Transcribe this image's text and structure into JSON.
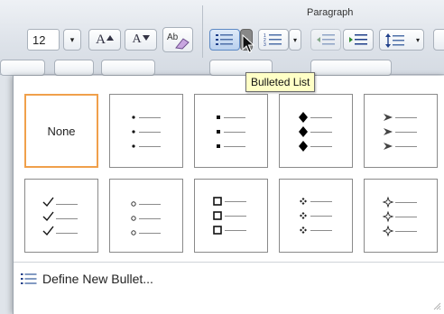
{
  "ribbon": {
    "group_title": "Paragraph",
    "font_size_value": "12",
    "font_size_arrow": "▾",
    "grow_font_label": "A",
    "shrink_font_label": "A",
    "clear_formatting_label": "Ab",
    "split_arrow": "▾",
    "bullets_icon": "bulleted-list-icon",
    "numbering_icon": "numbered-list-icon",
    "accent_color": "#5d89c4"
  },
  "tooltip": {
    "text": "Bulleted List"
  },
  "bullet_library": {
    "none_label": "None",
    "selected_border_color": "#f0a04b",
    "items": [
      {
        "name": "none"
      },
      {
        "name": "small-dot"
      },
      {
        "name": "square-dot"
      },
      {
        "name": "black-diamond"
      },
      {
        "name": "arrowhead"
      },
      {
        "name": "checkmark"
      },
      {
        "name": "hollow-circle"
      },
      {
        "name": "hollow-square"
      },
      {
        "name": "four-diamond"
      },
      {
        "name": "hollow-star"
      }
    ]
  },
  "define_new_bullet": {
    "label": "Define New Bullet..."
  }
}
